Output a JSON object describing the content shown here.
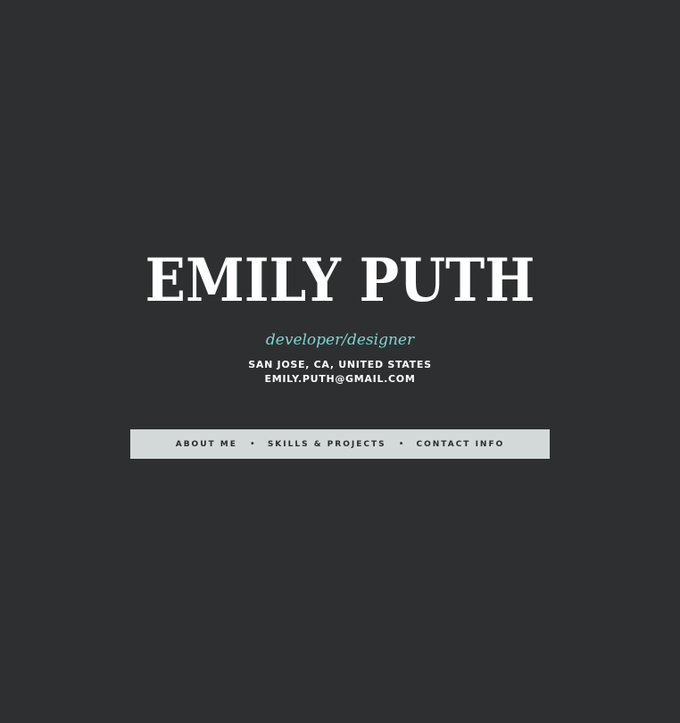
{
  "header": {
    "name": "EMILY PUTH",
    "tagline": "developer/designer",
    "location": "SAN JOSE, CA, UNITED STATES",
    "email": "EMILY.PUTH@GMAIL.COM"
  },
  "nav": {
    "items": [
      {
        "label": "ABOUT ME"
      },
      {
        "label": "SKILLS & PROJECTS"
      },
      {
        "label": "CONTACT INFO"
      }
    ],
    "separator": "•"
  },
  "colors": {
    "background": "#2e2f31",
    "name": "#ffffff",
    "tagline": "#7fd6d0",
    "nav_background": "#d3d9d9",
    "nav_text": "#2a2b2d"
  }
}
